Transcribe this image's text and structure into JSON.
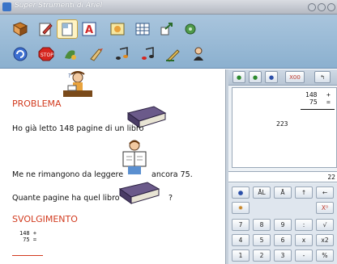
{
  "window": {
    "title": "Super Strumenti di Ariel"
  },
  "toolbar": {
    "row1_icons": [
      "book-icon",
      "pencil-paper-icon",
      "document-icon",
      "letter-a-icon",
      "image-icon",
      "grid-icon",
      "arrow-icon",
      "settings-icon"
    ],
    "row2_icons": [
      "refresh-icon",
      "stop-icon",
      "paint-icon",
      "brush-icon",
      "music-note-icon",
      "music-note-icon",
      "pen-icon",
      "character-icon"
    ]
  },
  "problem": {
    "heading": "PROBLEMA",
    "line1": "Ho già letto 148 pagine di un libro",
    "line2_start": "Me ne rimangono da leggere",
    "line2_end": "ancora 75.",
    "line3": "Quante pagine ha quel libro",
    "line3_end": "?"
  },
  "solution": {
    "heading": "SVOLGIMENTO",
    "op_line1": "148 +",
    "op_line2": " 75 ="
  },
  "calculator": {
    "top_buttons": [
      "●",
      "●",
      "●",
      "X00",
      "↰"
    ],
    "screen": {
      "n1": "148",
      "op1": "+",
      "n2": "75",
      "op2": "=",
      "result": "223"
    },
    "display": "22",
    "function_row": [
      "●",
      "ĀL",
      "Ā",
      "↑",
      "←"
    ],
    "row2": [
      "✹",
      "X⁰"
    ],
    "digits": [
      [
        "7",
        "8",
        "9",
        ":",
        "√"
      ],
      [
        "4",
        "5",
        "6",
        "x",
        "x2"
      ],
      [
        "1",
        "2",
        "3",
        "-",
        "%"
      ]
    ]
  }
}
